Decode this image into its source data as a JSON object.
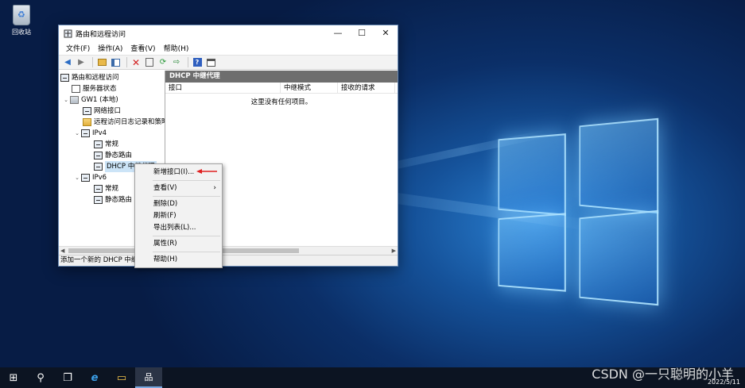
{
  "desktop": {
    "recycle_bin_label": "回收站",
    "watermark": "CSDN @一只聪明的小羊"
  },
  "window": {
    "title": "路由和远程访问",
    "controls": {
      "minimize": "—",
      "maximize": "☐",
      "close": "✕"
    },
    "menus": [
      "文件(F)",
      "操作(A)",
      "查看(V)",
      "帮助(H)"
    ],
    "toolbar_icons": [
      "back-icon",
      "forward-icon",
      "up-folder-icon",
      "show-hide-tree-icon",
      "delete-icon",
      "properties-icon",
      "refresh-icon",
      "export-icon",
      "help-icon",
      "console-icon"
    ]
  },
  "tree": {
    "items": [
      {
        "label": "路由和远程访问",
        "icon": "router-icon",
        "expander": ""
      },
      {
        "label": "服务器状态",
        "icon": "list-icon",
        "expander": ""
      },
      {
        "label": "GW1 (本地)",
        "icon": "server-icon",
        "expander": "⌄"
      },
      {
        "label": "网络接口",
        "icon": "router-icon",
        "expander": ""
      },
      {
        "label": "远程访问日志记录和策略",
        "icon": "folder-icon",
        "expander": ""
      },
      {
        "label": "IPv4",
        "icon": "router-icon",
        "expander": "⌄"
      },
      {
        "label": "常规",
        "icon": "router-icon",
        "expander": ""
      },
      {
        "label": "静态路由",
        "icon": "router-icon",
        "expander": ""
      },
      {
        "label": "DHCP 中继代理",
        "icon": "router-icon",
        "expander": ""
      },
      {
        "label": "IPv6",
        "icon": "router-icon",
        "expander": "⌄"
      },
      {
        "label": "常规",
        "icon": "router-icon",
        "expander": ""
      },
      {
        "label": "静态路由",
        "icon": "router-icon",
        "expander": ""
      }
    ]
  },
  "detail": {
    "header": "DHCP 中继代理",
    "columns": [
      "接口",
      "中继模式",
      "接收的请求"
    ],
    "empty_message": "这里没有任何项目。"
  },
  "status_bar": "添加一个新的 DHCP 中继",
  "context_menu": {
    "items": [
      {
        "label": "新增接口(I)...",
        "submenu": false
      },
      {
        "label": "查看(V)",
        "submenu": true
      },
      {
        "label": "删除(D)",
        "submenu": false
      },
      {
        "label": "刷新(F)",
        "submenu": false
      },
      {
        "label": "导出列表(L)...",
        "submenu": false
      },
      {
        "label": "属性(R)",
        "submenu": false
      },
      {
        "label": "帮助(H)",
        "submenu": false
      }
    ],
    "submenu_arrow": "›"
  },
  "taskbar": {
    "icons": [
      "windows-start-icon",
      "search-icon",
      "task-view-icon",
      "internet-explorer-icon",
      "file-explorer-icon",
      "routing-remote-access-icon"
    ],
    "glyphs": [
      "⊞",
      "⚲",
      "❐",
      "e",
      "▭",
      "品"
    ],
    "tray_date": "2022/5/11"
  },
  "colors": {
    "accent": "#1e6fd0",
    "detail_header_bg": "#6e6e6e",
    "selection": "#cce4f7",
    "annotation_arrow": "#e02020"
  }
}
